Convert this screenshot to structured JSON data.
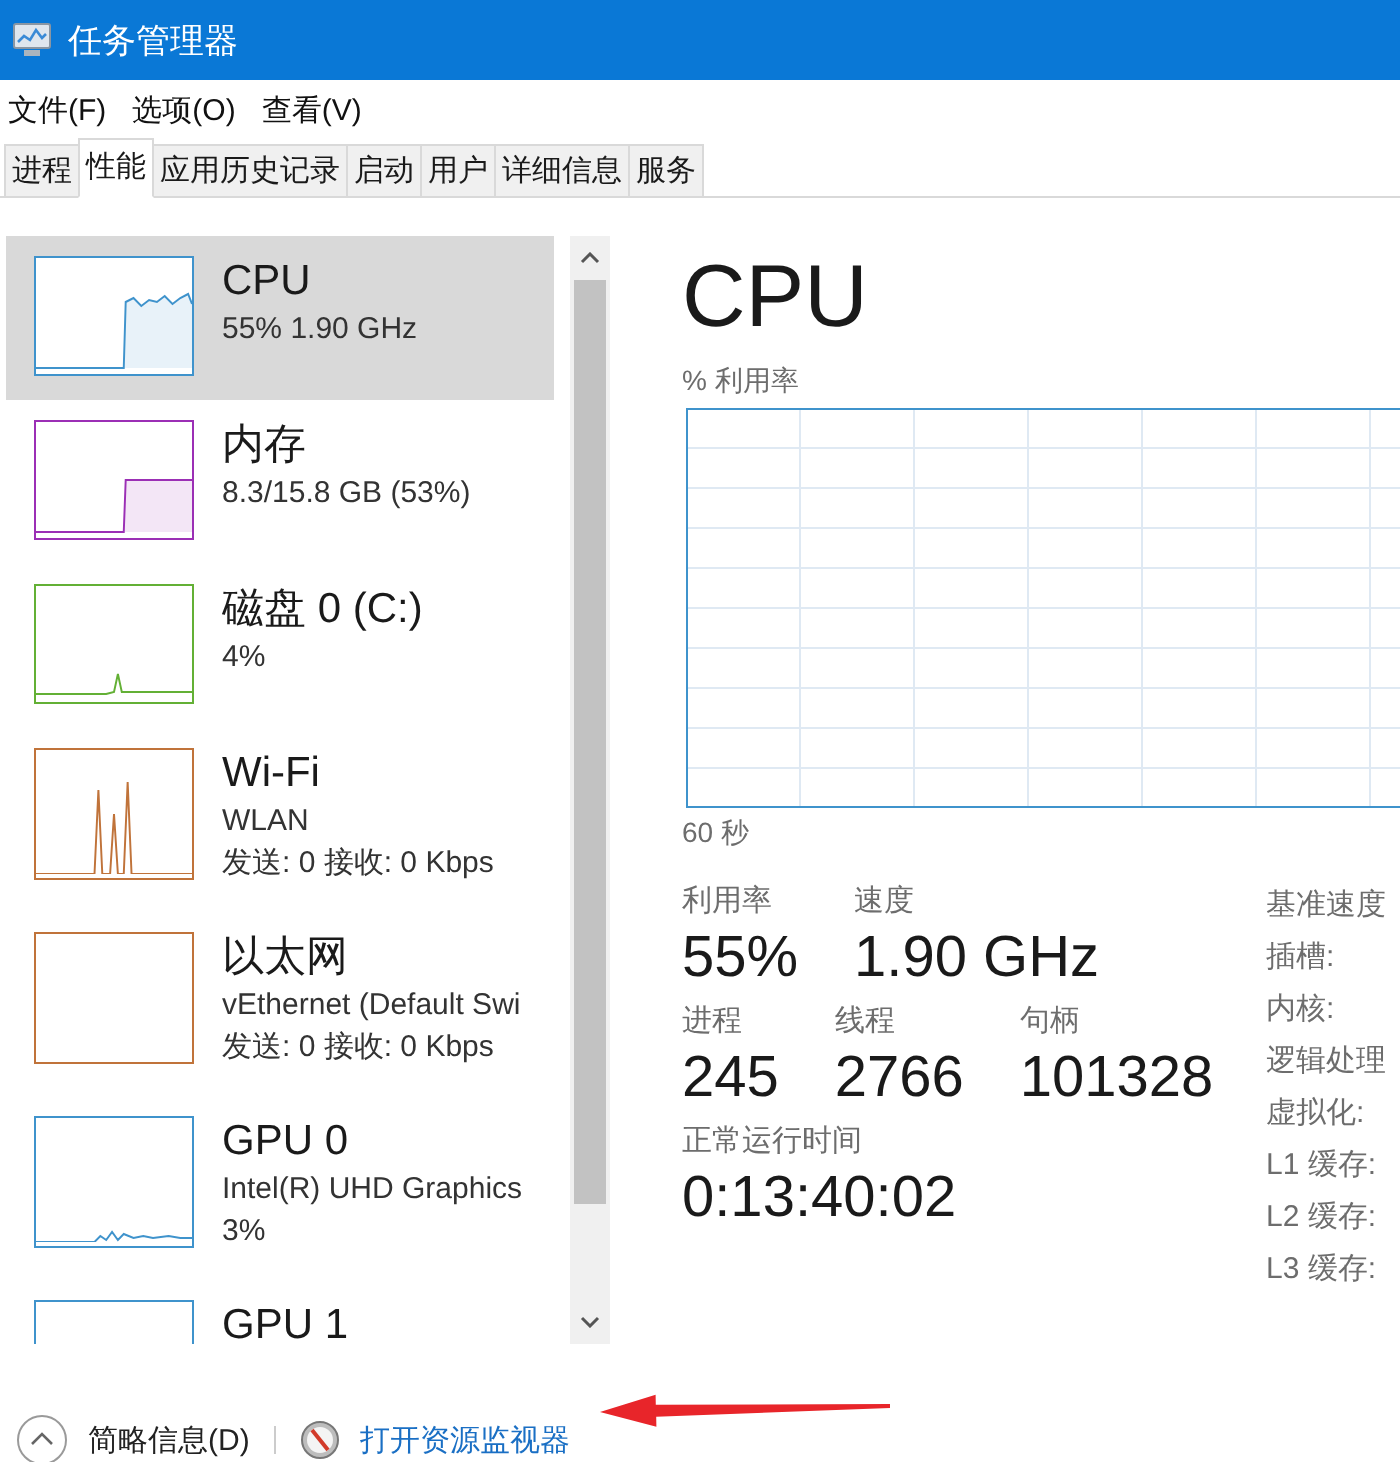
{
  "window": {
    "title": "任务管理器"
  },
  "menu": [
    "文件(F)",
    "选项(O)",
    "查看(V)"
  ],
  "tabs": [
    {
      "label": "进程",
      "selected": false
    },
    {
      "label": "性能",
      "selected": true
    },
    {
      "label": "应用历史记录",
      "selected": false
    },
    {
      "label": "启动",
      "selected": false
    },
    {
      "label": "用户",
      "selected": false
    },
    {
      "label": "详细信息",
      "selected": false
    },
    {
      "label": "服务",
      "selected": false
    }
  ],
  "sidebar": {
    "items": [
      {
        "name": "CPU",
        "lines": [
          "55% 1.90 GHz"
        ],
        "color": "#3f93cc",
        "kind": "step-noisy",
        "selected": true
      },
      {
        "name": "内存",
        "lines": [
          "8.3/15.8 GB (53%)"
        ],
        "color": "#9b2fb5",
        "kind": "step",
        "selected": false
      },
      {
        "name": "磁盘 0 (C:)",
        "lines": [
          "4%"
        ],
        "color": "#63b035",
        "kind": "spike",
        "selected": false
      },
      {
        "name": "Wi-Fi",
        "lines": [
          "WLAN",
          "发送: 0 接收: 0 Kbps"
        ],
        "color": "#c0733a",
        "kind": "spikes",
        "selected": false
      },
      {
        "name": "以太网",
        "lines": [
          "vEthernet (Default Swi",
          "发送: 0 接收: 0 Kbps"
        ],
        "color": "#c0733a",
        "kind": "flat",
        "selected": false
      },
      {
        "name": "GPU 0",
        "lines": [
          "Intel(R) UHD Graphics",
          "3%"
        ],
        "color": "#3f93cc",
        "kind": "noise",
        "selected": false
      },
      {
        "name": "GPU 1",
        "color": "#3f93cc",
        "kind": "flat",
        "selected": false
      }
    ]
  },
  "detail": {
    "title": "CPU",
    "graph_label": "% 利用率",
    "time_label": "60 秒",
    "stat_rows": [
      [
        {
          "label": "利用率",
          "value": "55%"
        },
        {
          "label": "速度",
          "value": "1.90 GHz"
        }
      ],
      [
        {
          "label": "进程",
          "value": "245"
        },
        {
          "label": "线程",
          "value": "2766"
        },
        {
          "label": "句柄",
          "value": "101328"
        }
      ],
      [
        {
          "label": "正常运行时间",
          "value": "0:13:40:02"
        }
      ]
    ],
    "specs": [
      "基准速度",
      "插槽:",
      "内核:",
      "逻辑处理",
      "虚拟化:",
      "L1 缓存:",
      "L2 缓存:",
      "L3 缓存:"
    ]
  },
  "footer": {
    "collapse_label": "简略信息(D)",
    "link": "打开资源监视器"
  }
}
